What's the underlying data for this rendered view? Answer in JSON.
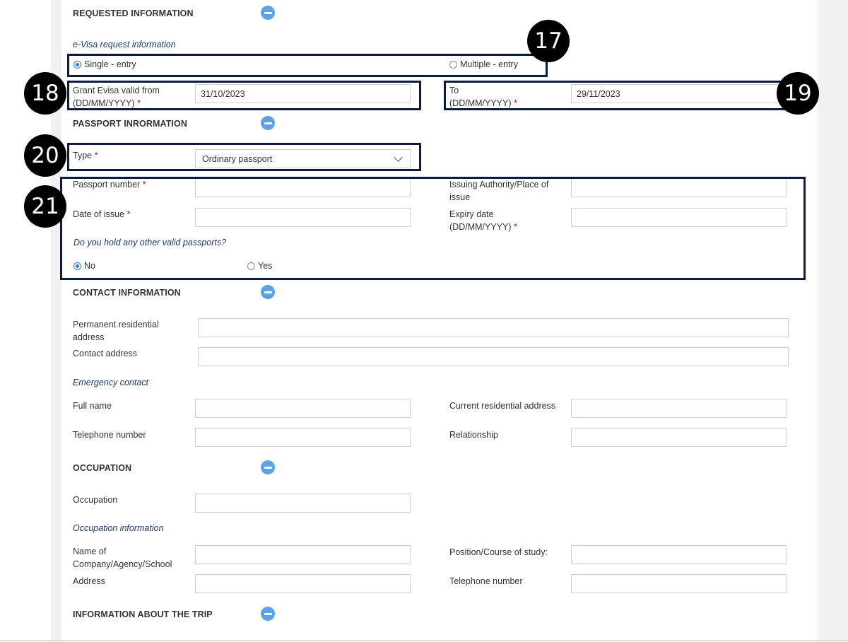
{
  "requested": {
    "title": "REQUESTED INFORMATION",
    "subheading": "e-Visa request information",
    "single_entry": "Single - entry",
    "multiple_entry": "Multiple - entry",
    "valid_from_label": "Grant Evisa valid from",
    "valid_from_format": "(DD/MM/YYYY)",
    "valid_from_value": "31/10/2023",
    "to_label": "To",
    "to_format": "(DD/MM/YYYY)",
    "to_value": "29/11/2023"
  },
  "passport": {
    "title": "PASSPORT INRORMATION",
    "type_label": "Type",
    "type_value": "Ordinary passport",
    "number_label": "Passport number",
    "issuing_label_1": "Issuing Authority/Place of",
    "issuing_label_2": "issue",
    "date_issue_label": "Date of issue",
    "expiry_label": "Expiry date",
    "expiry_format": "(DD/MM/YYYY)",
    "other_question": "Do you hold any other valid passports?",
    "no_label": "No",
    "yes_label": "Yes"
  },
  "contact": {
    "title": "CONTACT INFORMATION",
    "permanent_label_1": "Permanent residential",
    "permanent_label_2": "address",
    "contact_address_label": "Contact address",
    "emergency_heading": "Emergency contact",
    "full_name_label": "Full name",
    "current_address_label": "Current residential address",
    "telephone_label": "Telephone number",
    "relationship_label": "Relationship"
  },
  "occupation": {
    "title": "OCCUPATION",
    "occupation_label": "Occupation",
    "info_heading": "Occupation information",
    "company_label_1": "Name of",
    "company_label_2": "Company/Agency/School",
    "position_label": "Position/Course of study:",
    "address_label": "Address",
    "telephone_label": "Telephone number"
  },
  "trip": {
    "title": "INFORMATION ABOUT THE TRIP"
  },
  "required_mark": "*",
  "badges": {
    "b17": "17",
    "b18": "18",
    "b19": "19",
    "b20": "20",
    "b21": "21"
  },
  "colors": {
    "highlight_border": "#0d1b3e",
    "badge_bg": "#000000",
    "collapse_icon": "#5ba3e6",
    "radio_checked": "#2f7dd8",
    "required": "#d0021b",
    "subheading": "#1f3a68"
  }
}
